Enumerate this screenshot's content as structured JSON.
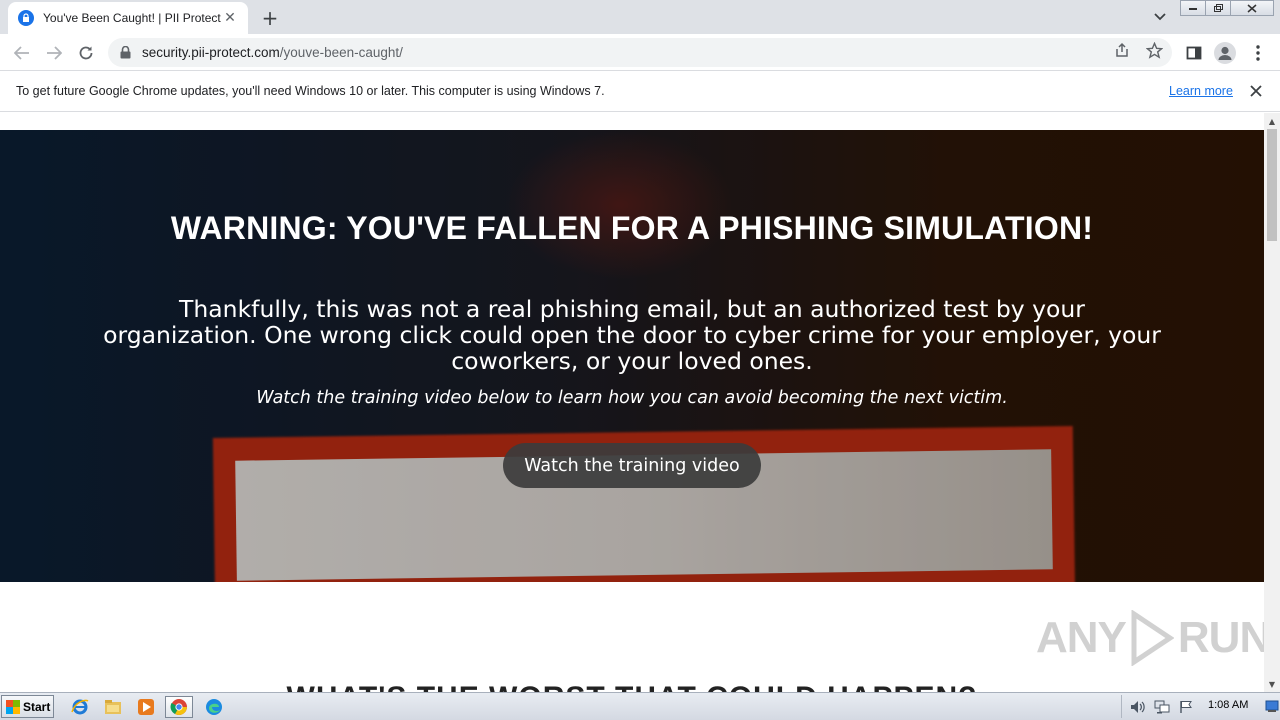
{
  "browser": {
    "tab_title": "You've Been Caught! | PII Protect",
    "tab_close": "✕",
    "new_tab": "+",
    "url_host": "security.pii-protect.com",
    "url_path": "/youve-been-caught/"
  },
  "infobar": {
    "message": "To get future Google Chrome updates, you'll need Windows 10 or later. This computer is using Windows 7.",
    "learn_more": "Learn more"
  },
  "hero": {
    "heading": "WARNING: YOU'VE FALLEN FOR A PHISHING SIMULATION!",
    "lead": "Thankfully, this was not a real phishing email, but an authorized test by your organization. One wrong click could open the door to cyber crime for your employer, your coworkers, or your loved ones.",
    "sub": "Watch the training video below to learn how you can avoid becoming the next victim.",
    "cta": "Watch the training video"
  },
  "next_section": {
    "heading": "WHAT'S THE WORST THAT COULD HAPPEN?"
  },
  "watermark": {
    "left": "ANY",
    "right": "RUN"
  },
  "taskbar": {
    "start_label": "Start",
    "clock": "1:08 AM"
  },
  "colors": {
    "accent": "#1a73e8",
    "hero_dark": "#0b1e33",
    "frame_red": "#b32a12"
  }
}
